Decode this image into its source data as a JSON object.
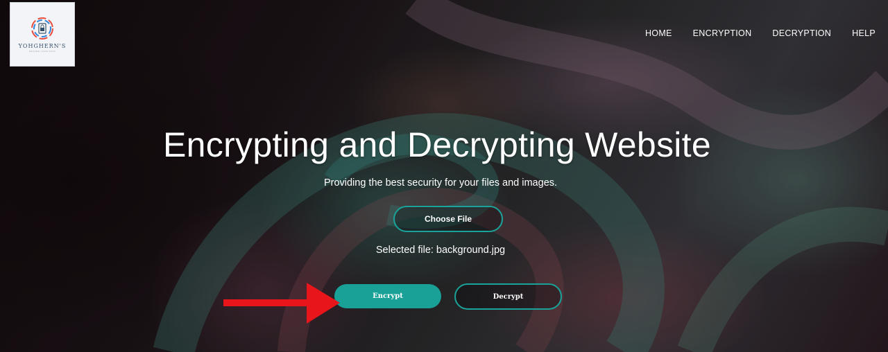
{
  "brand": {
    "logo_text": "YOHGHERN'S",
    "logo_subtext": "SECURE YOUR DATA"
  },
  "nav": {
    "items": [
      "HOME",
      "ENCRYPTION",
      "DECRYPTION",
      "HELP"
    ]
  },
  "hero": {
    "title": "Encrypting and Decrypting Website",
    "subtitle": "Providing the best security for your files and images."
  },
  "file": {
    "choose_label": "Choose File",
    "selected_label": "Selected file:",
    "selected_name": "background.jpg"
  },
  "actions": {
    "encrypt_label": "Encrypt",
    "decrypt_label": "Decrypt"
  },
  "annotation": {
    "icon": "red-arrow-icon",
    "color": "#e8151b"
  },
  "colors": {
    "accent": "#19a097",
    "text": "#ffffff"
  }
}
